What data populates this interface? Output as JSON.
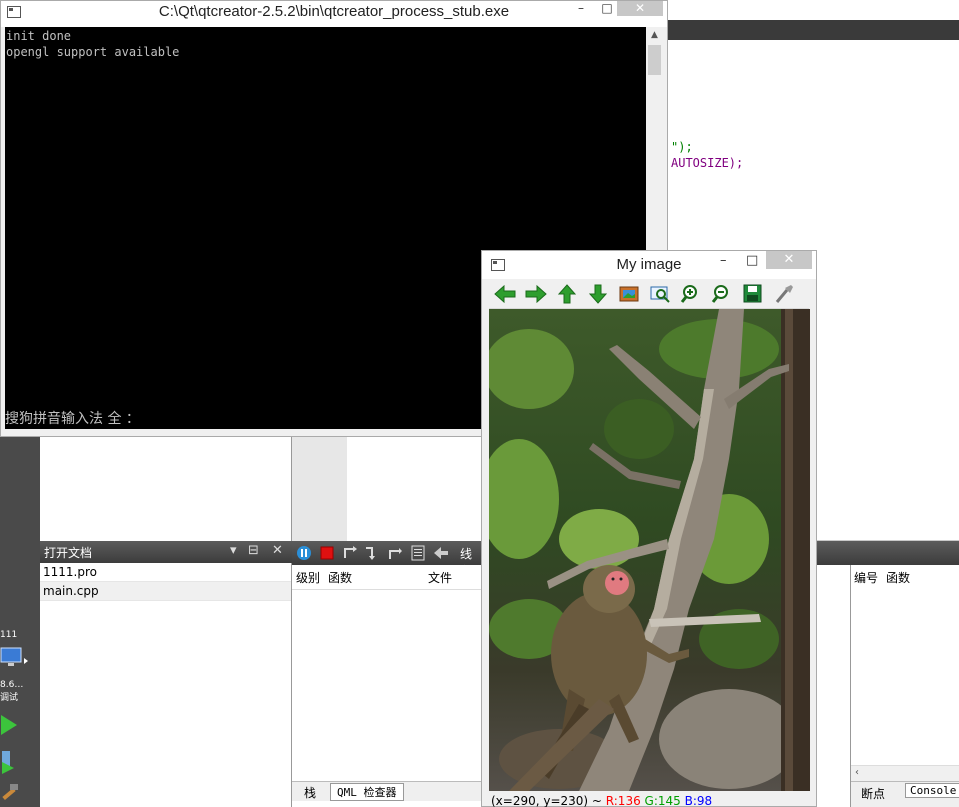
{
  "editor": {
    "line1": "\");",
    "line2": "AUTOSIZE);"
  },
  "sidebar": {
    "project_label": "111",
    "kit_label": "8.6…",
    "mode_label": "调试"
  },
  "open_docs": {
    "title": "打开文档",
    "files": [
      "1111.pro",
      "main.cpp"
    ]
  },
  "debug_toolbar": {
    "threads_label": "线程"
  },
  "stack": {
    "headers": [
      "级别",
      "函数",
      "文件"
    ],
    "tabs": [
      "栈",
      "QML 检查器"
    ]
  },
  "breakpoints": {
    "headers": [
      "编号",
      "函数"
    ],
    "tabs": [
      "断点",
      "Console"
    ]
  },
  "console": {
    "title": "C:\\Qt\\qtcreator-2.5.2\\bin\\qtcreator_process_stub.exe",
    "close_label": "✕",
    "lines": [
      "init done",
      "opengl support available"
    ],
    "ime_text": "搜狗拼音输入法 全 ："
  },
  "image_window": {
    "title": "My image",
    "minimize": "–",
    "maximize": "□",
    "close": "✕",
    "toolbar_icons": [
      "arrow-left-icon",
      "arrow-right-icon",
      "arrow-up-icon",
      "arrow-down-icon",
      "image-icon",
      "zoom-fit-icon",
      "zoom-in-icon",
      "zoom-out-icon",
      "save-icon",
      "properties-icon"
    ],
    "status": {
      "coords": "(x=290, y=230) ~ ",
      "r": "R:136",
      "g": "G:145",
      "b": "B:98"
    },
    "colors": {
      "r": "#ff0000",
      "g": "#00a000",
      "b": "#0000ff"
    }
  }
}
